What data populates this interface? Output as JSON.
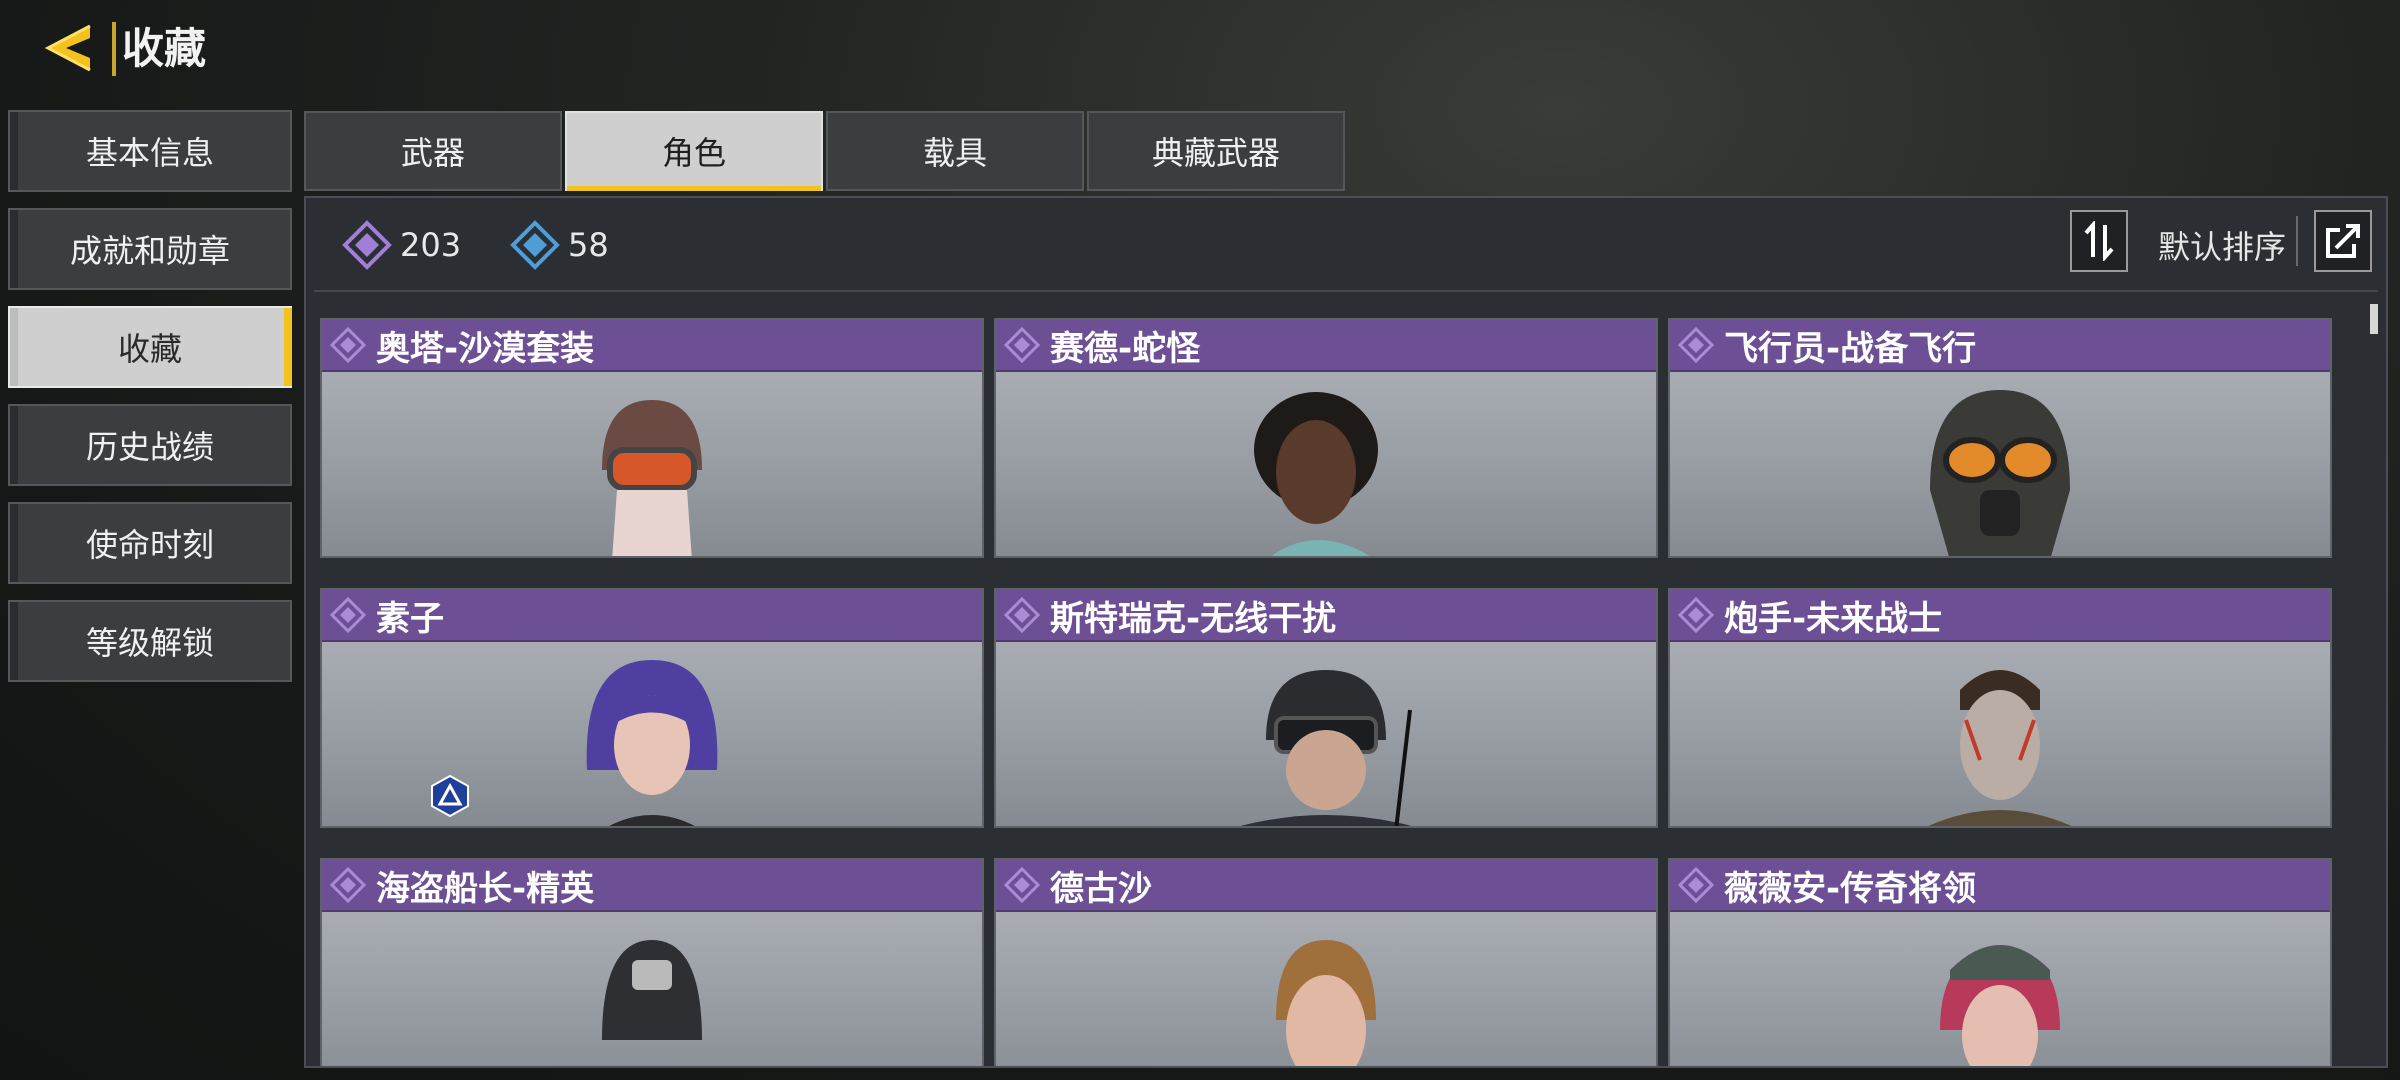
{
  "header": {
    "title": "收藏"
  },
  "sidebar": {
    "items": [
      {
        "label": "基本信息"
      },
      {
        "label": "成就和勋章"
      },
      {
        "label": "收藏"
      },
      {
        "label": "历史战绩"
      },
      {
        "label": "使命时刻"
      },
      {
        "label": "等级解锁"
      }
    ],
    "active_index": 2
  },
  "tabs": [
    {
      "label": "武器"
    },
    {
      "label": "角色"
    },
    {
      "label": "载具"
    },
    {
      "label": "典藏武器"
    }
  ],
  "active_tab_index": 1,
  "counters": {
    "purple": "203",
    "blue": "58"
  },
  "sort": {
    "label": "默认排序"
  },
  "cards": [
    {
      "name": "奥塔-沙漠套装"
    },
    {
      "name": "赛德-蛇怪"
    },
    {
      "name": "飞行员-战备飞行"
    },
    {
      "name": "素子"
    },
    {
      "name": "斯特瑞克-无线干扰"
    },
    {
      "name": "炮手-未来战士"
    },
    {
      "name": "海盗船长-精英"
    },
    {
      "name": "德古沙"
    },
    {
      "name": "薇薇安-传奇将领"
    }
  ],
  "colors": {
    "accent": "#f2c31c",
    "card_header": "#6d4f95",
    "purple_icon": "#a27fd6",
    "blue_icon": "#4f9ed8"
  },
  "icons": {
    "back": "back-arrow-icon",
    "sort": "sort-arrows-icon",
    "share": "share-icon",
    "diamond": "diamond-icon"
  }
}
